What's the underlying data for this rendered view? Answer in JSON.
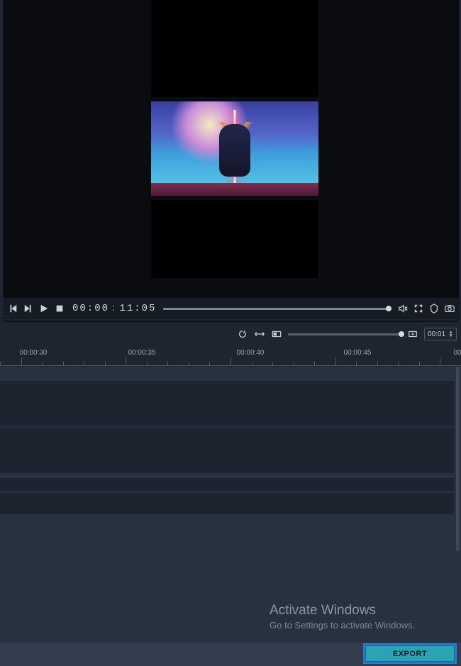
{
  "player": {
    "timecode_current": "00:00",
    "timecode_total": "11:05",
    "progress_pct": 100
  },
  "timeline": {
    "zoom_pct": 100,
    "step_value": "00:01",
    "ruler": [
      "00:00:30",
      "00:00:35",
      "00:00:40",
      "00:00:45",
      "00"
    ]
  },
  "watermark": {
    "title": "Activate Windows",
    "subtitle": "Go to Settings to activate Windows."
  },
  "buttons": {
    "export": "EXPORT"
  },
  "icons": {
    "prev": "previous-frame-icon",
    "next": "next-frame-icon",
    "play": "play-icon",
    "stop": "stop-icon",
    "mute": "mute-icon",
    "fullscreen": "fullscreen-icon",
    "safezone": "safezone-icon",
    "camera": "camera-icon",
    "refresh": "refresh-icon",
    "fit": "fit-width-icon",
    "ratio": "aspect-ratio-icon",
    "add_marker": "add-marker-icon"
  }
}
